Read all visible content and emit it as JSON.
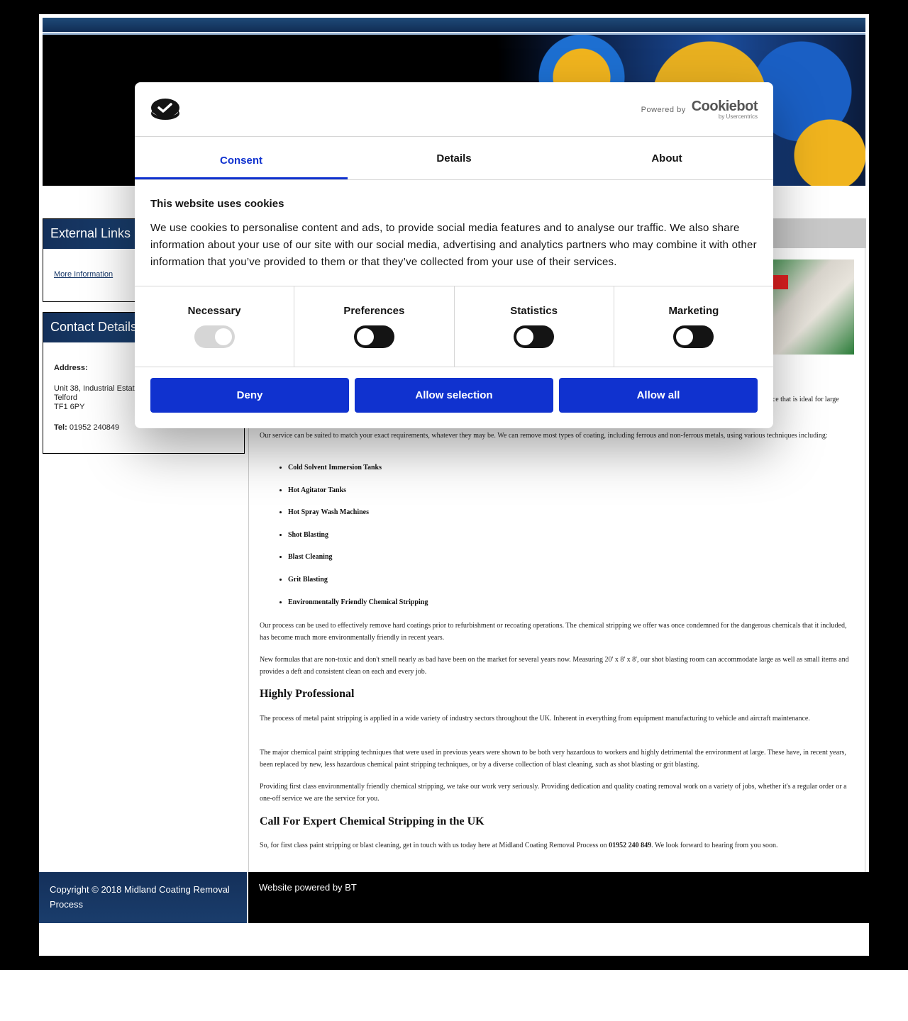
{
  "site": {
    "sidebar": {
      "external_links": {
        "title": "External Links",
        "link": "More Information"
      },
      "contact": {
        "title": "Contact Details",
        "address_label": "Address:",
        "address_lines": [
          "Unit 38, Industrial Estat",
          "Telford",
          "TF1 6PY"
        ],
        "tel_label": "Tel:",
        "tel": "01952 240849"
      }
    },
    "content": {
      "partial_snippet": "ice that is ideal for large",
      "intro": "Our service can be suited to match your exact requirements, whatever they may be. We can remove most types of coating, including ferrous and non-ferrous metals, using various techniques including:",
      "techniques": [
        "Cold Solvent Immersion Tanks",
        "Hot Agitator Tanks",
        "Hot Spray Wash Machines",
        "Shot Blasting",
        "Blast Cleaning",
        "Grit Blasting",
        "Environmentally Friendly Chemical Stripping"
      ],
      "para1": "Our process can be used to effectively remove hard coatings prior to refurbishment or recoating operations. The chemical stripping we offer was once condemned for the dangerous chemicals that it included, has become much more environmentally friendly in recent years.",
      "para2": "New formulas that are non-toxic and don't smell nearly as bad have been on the market for several years now. Measuring 20' x 8' x 8', our shot blasting room can accommodate large as well as small items and provides a deft and consistent clean on each and every job.",
      "heading1": "Highly Professional",
      "para3": "The process of metal paint stripping is applied in a wide variety of industry sectors throughout the UK. Inherent in everything from equipment manufacturing to vehicle and aircraft maintenance.",
      "para4": "The major chemical paint stripping techniques that were used in previous years were shown to be both very hazardous to workers and highly detrimental the environment at large. These have, in recent years, been replaced by new, less hazardous chemical paint stripping techniques, or by a diverse collection of blast cleaning, such as shot blasting or grit blasting.",
      "para5": "Providing first class environmentally friendly chemical stripping, we take our work very seriously. Providing dedication and quality coating removal work on a variety of jobs, whether it's a regular order or a one-off service we are the service for you.",
      "heading2": "Call For Expert Chemical Stripping in the UK",
      "cta_before": "So, for first class paint stripping or blast cleaning, get in touch with us today here at Midland Coating Removal Process on ",
      "cta_phone": "01952 240 849",
      "cta_after": ". We look forward to hearing from you soon."
    },
    "footer": {
      "copyright": "Copyright © 2018 Midland Coating Removal Process",
      "powered": "Website powered by BT"
    }
  },
  "cookie_dialog": {
    "powered_by": "Powered by",
    "brand": "Cookiebot",
    "brand_sub": "by Usercentrics",
    "tabs": [
      {
        "label": "Consent",
        "active": true
      },
      {
        "label": "Details",
        "active": false
      },
      {
        "label": "About",
        "active": false
      }
    ],
    "title": "This website uses cookies",
    "text": "We use cookies to personalise content and ads, to provide social media features and to analyse our traffic. We also share information about your use of our site with our social media, advertising and analytics partners who may combine it with other information that you’ve provided to them or that they’ve collected from your use of their services.",
    "categories": [
      {
        "label": "Necessary",
        "enabled": true,
        "locked": true
      },
      {
        "label": "Preferences",
        "enabled": false,
        "locked": false
      },
      {
        "label": "Statistics",
        "enabled": false,
        "locked": false
      },
      {
        "label": "Marketing",
        "enabled": false,
        "locked": false
      }
    ],
    "buttons": {
      "deny": "Deny",
      "allow_selection": "Allow selection",
      "allow_all": "Allow all"
    },
    "accent_color": "#1032cf"
  }
}
